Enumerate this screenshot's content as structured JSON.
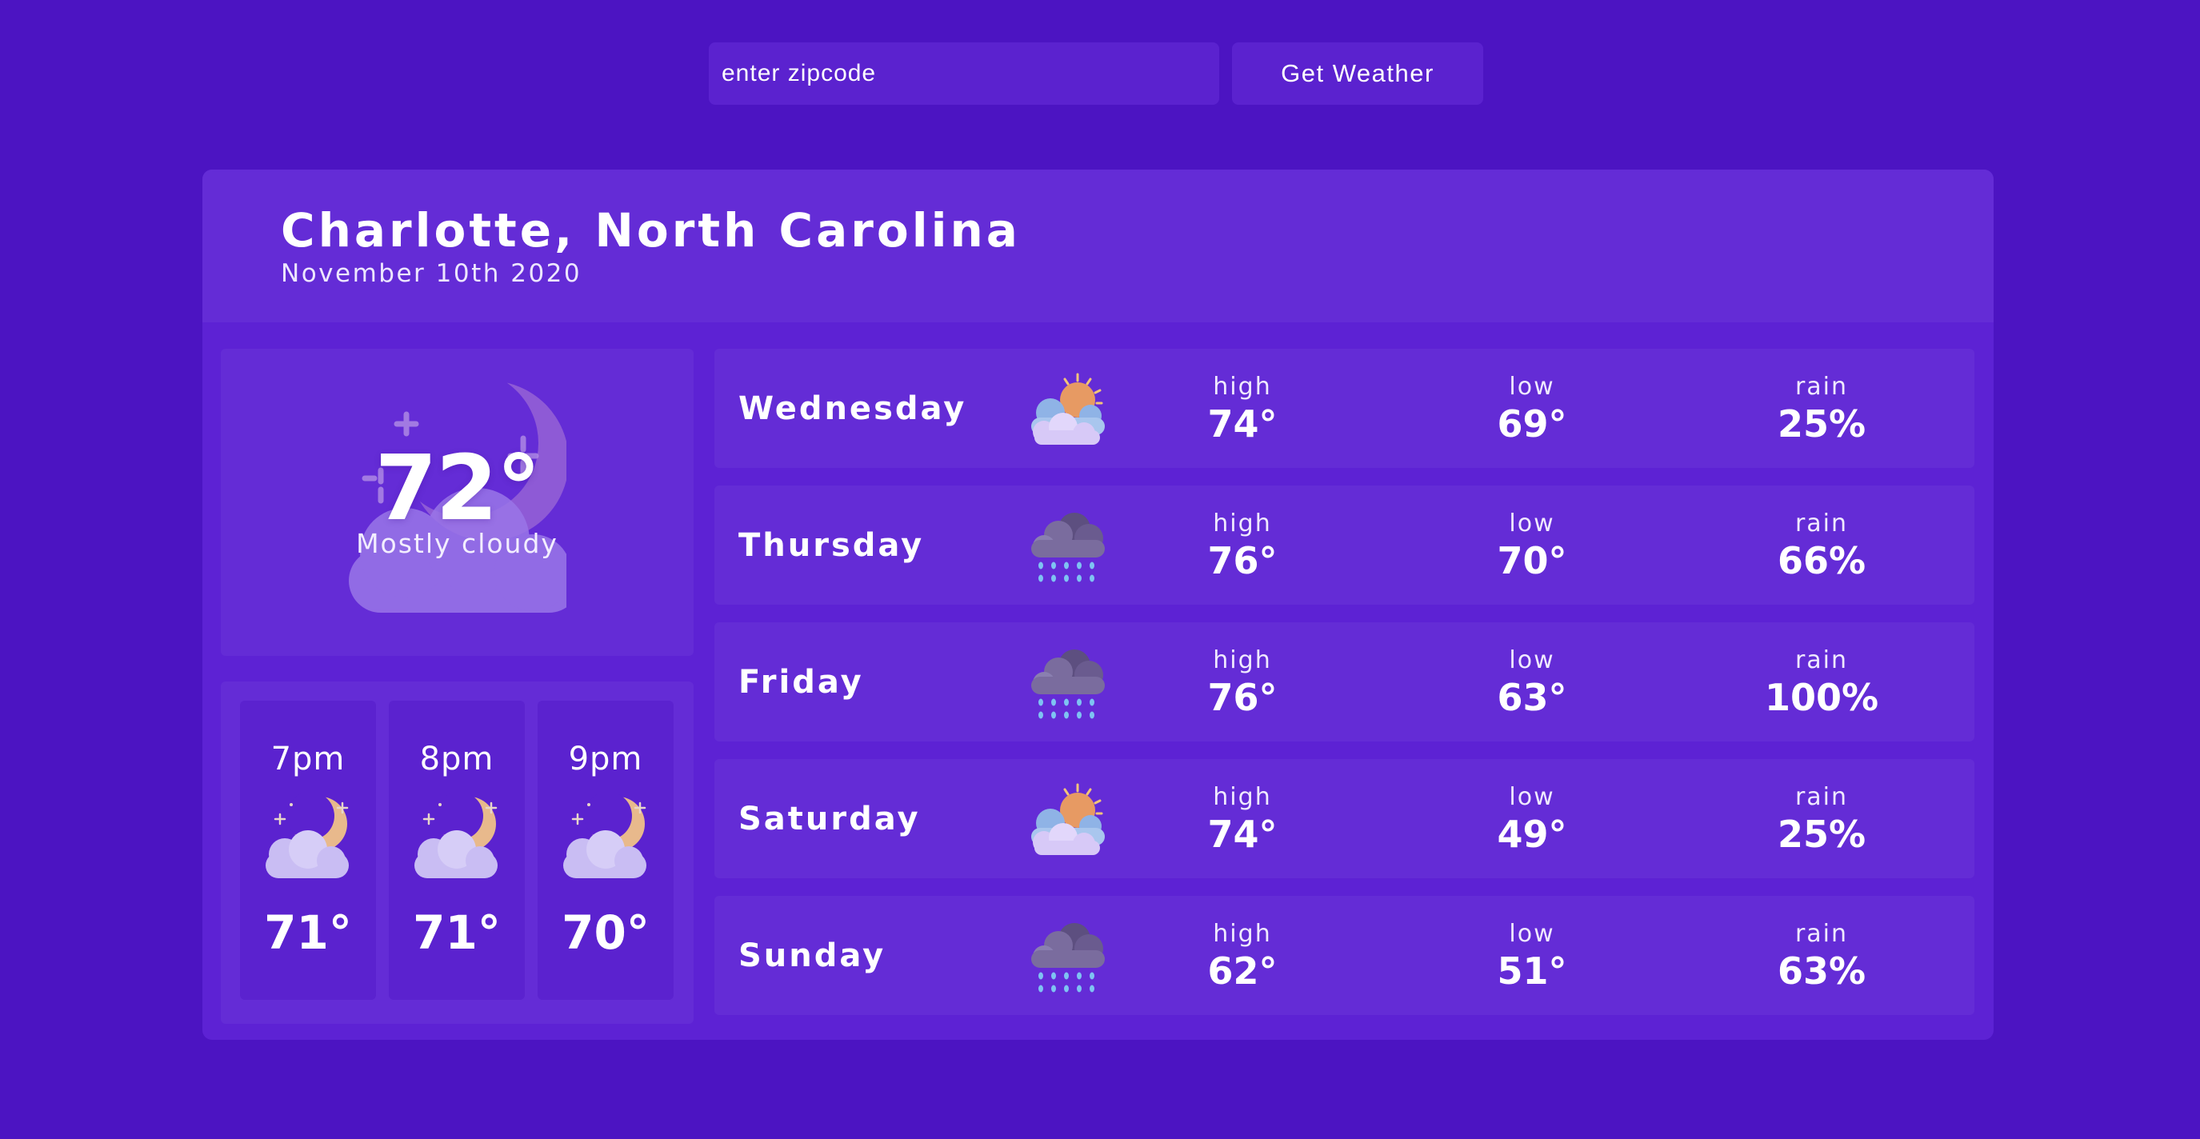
{
  "search": {
    "placeholder": "enter zipcode",
    "value": "",
    "button_label": "Get Weather"
  },
  "location": {
    "city": "Charlotte, North Carolina",
    "date": "November 10th 2020"
  },
  "current": {
    "temp": "72°",
    "condition": "Mostly cloudy",
    "icon": "night-cloud-moon-icon"
  },
  "hourly": [
    {
      "time": "7pm",
      "temp": "71°",
      "icon": "night-cloud-moon-icon"
    },
    {
      "time": "8pm",
      "temp": "71°",
      "icon": "night-cloud-moon-icon"
    },
    {
      "time": "9pm",
      "temp": "70°",
      "icon": "night-cloud-moon-icon"
    }
  ],
  "labels": {
    "high": "high",
    "low": "low",
    "rain": "rain"
  },
  "daily": [
    {
      "day": "Wednesday",
      "icon": "partly-cloudy-sun-icon",
      "high": "74°",
      "low": "69°",
      "rain": "25%"
    },
    {
      "day": "Thursday",
      "icon": "rain-cloud-icon",
      "high": "76°",
      "low": "70°",
      "rain": "66%"
    },
    {
      "day": "Friday",
      "icon": "rain-cloud-icon",
      "high": "76°",
      "low": "63°",
      "rain": "100%"
    },
    {
      "day": "Saturday",
      "icon": "partly-cloudy-sun-icon",
      "high": "74°",
      "low": "49°",
      "rain": "25%"
    },
    {
      "day": "Sunday",
      "icon": "rain-cloud-icon",
      "high": "62°",
      "low": "51°",
      "rain": "63%"
    }
  ],
  "colors": {
    "background": "#4c14c2",
    "card": "#5d22d4",
    "panel": "#642cd6",
    "moon": "#e8b98c",
    "cloud": "#c9bdf3",
    "rain_drop": "#7ec3f2"
  }
}
